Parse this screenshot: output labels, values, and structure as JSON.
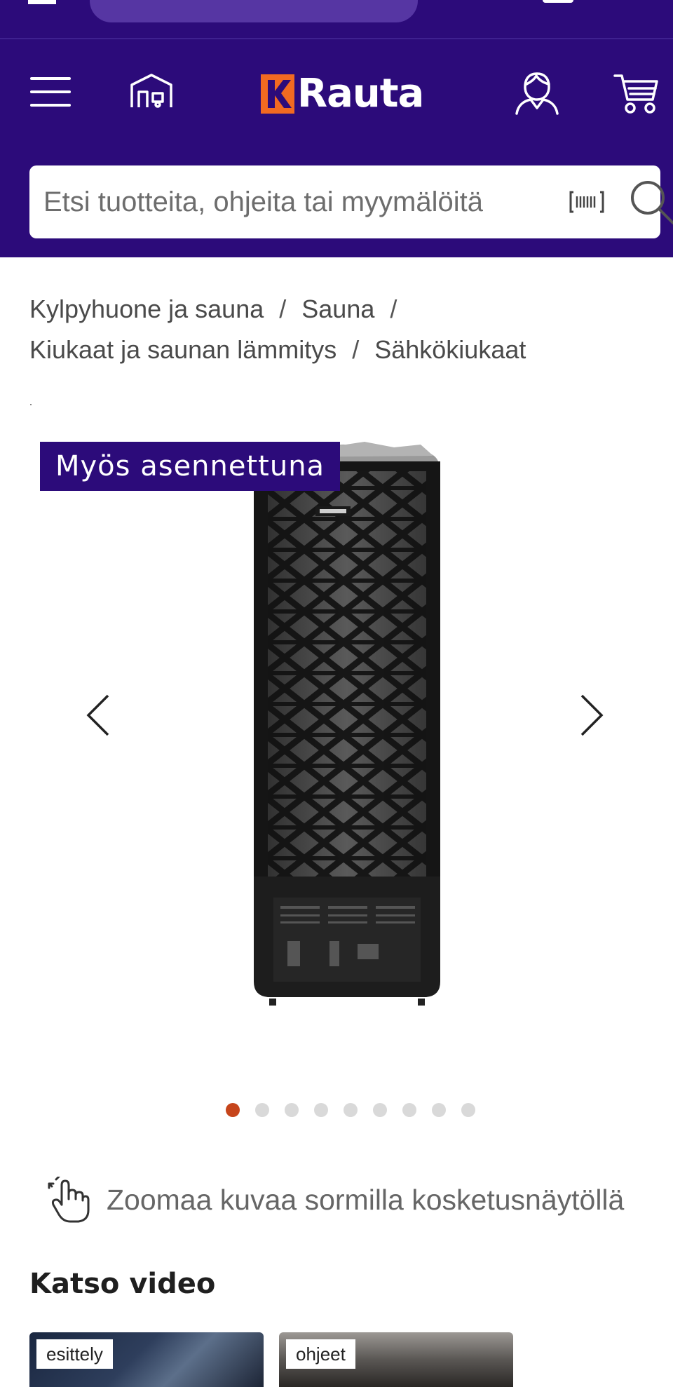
{
  "header": {
    "logo_text": "Rauta",
    "logo_mark": "K",
    "icons": {
      "menu": "hamburger-menu-icon",
      "store": "store-icon",
      "account": "account-icon",
      "cart": "cart-icon"
    },
    "colors": {
      "brand_purple": "#2c0b7a",
      "logo_orange": "#f26a21"
    }
  },
  "search": {
    "placeholder": "Etsi tuotteita, ohjeita tai myymälöitä",
    "icons": {
      "barcode": "barcode-scan-icon",
      "search": "search-icon"
    }
  },
  "breadcrumb": {
    "items": [
      "Kylpyhuone ja sauna",
      "Sauna",
      "Kiukaat ja saunan lämmitys",
      "Sähkökiukaat"
    ]
  },
  "gallery": {
    "badge": "Myös asennettuna",
    "image_alt": "Sähkökiuas",
    "image_count": 9,
    "active_index": 0
  },
  "zoom_hint": {
    "text": "Zoomaa kuvaa sormilla kosketusnäytöllä",
    "icon": "pinch-hand-icon"
  },
  "videos": {
    "heading": "Katso video",
    "items": [
      {
        "tag": "esittely"
      },
      {
        "tag": "ohjeet"
      }
    ]
  },
  "colors": {
    "dot_active": "#c6451b",
    "dot_inactive": "#d9d9d9"
  }
}
